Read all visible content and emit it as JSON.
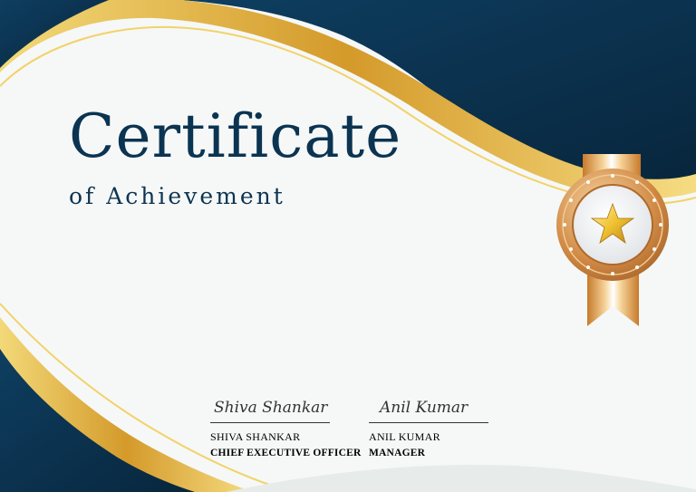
{
  "certificate": {
    "title": "Certificate",
    "subtitle": "of Achievement",
    "colors": {
      "navy": "#0b3452",
      "gold": "#d9a533",
      "light_gold": "#f2d26a",
      "bronze": "#c8813d",
      "background": "#f6f8f7"
    },
    "signatures": [
      {
        "signature_script": "Shiva Shankar",
        "name": "SHIVA SHANKAR",
        "role": "CHIEF EXECUTIVE OFFICER"
      },
      {
        "signature_script": "Anil Kumar",
        "name": "ANIL KUMAR",
        "role": "MANAGER"
      }
    ],
    "medal": {
      "icon": "star-icon"
    }
  }
}
